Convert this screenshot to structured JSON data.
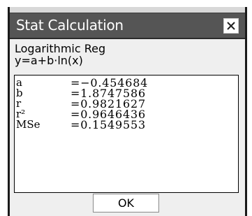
{
  "dialog": {
    "title": "Stat Calculation",
    "close_icon": "close-icon"
  },
  "header": {
    "regression_type": "Logarithmic Reg",
    "equation": "y=a+b·ln(x)"
  },
  "results": [
    {
      "name": "a",
      "value": "=−0.454684"
    },
    {
      "name": "b",
      "value": "=1.8747586"
    },
    {
      "name": "r",
      "value": "=0.9821627"
    },
    {
      "name": "r²",
      "value": "=0.9646436"
    },
    {
      "name": "MSe",
      "value": "=0.1549553"
    }
  ],
  "buttons": {
    "ok_label": "OK"
  }
}
